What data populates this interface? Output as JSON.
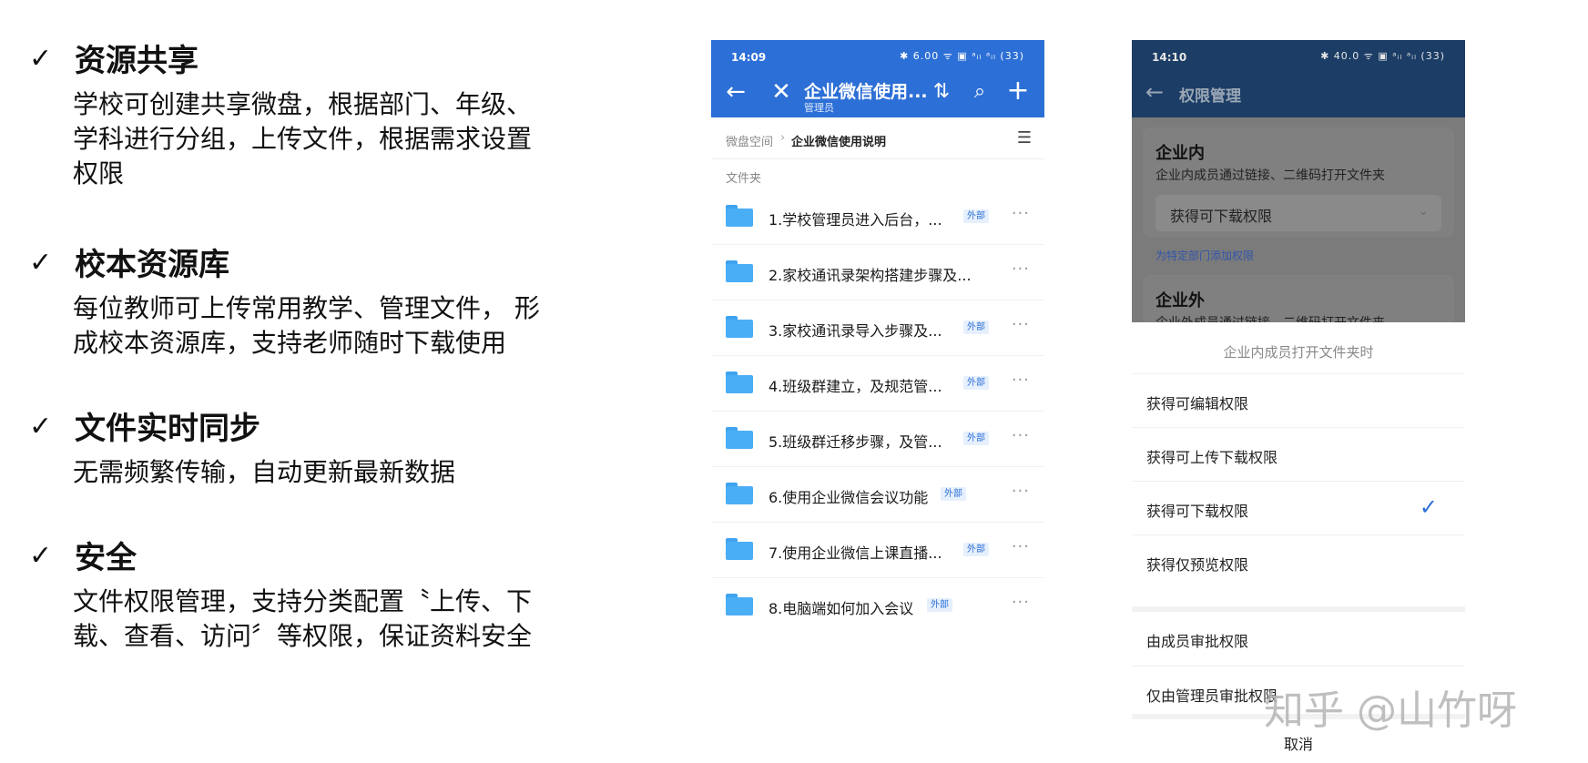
{
  "features": [
    {
      "title": "资源共享",
      "desc": "学校可创建共享微盘，根据部门、年级、\n 学科进行分组，上传文件，根据需求设置\n 权限"
    },
    {
      "title": "校本资源库",
      "desc": "每位教师可上传常用教学、管理文件，  形\n 成校本资源库，支持老师随时下载使用"
    },
    {
      "title": "文件实时同步",
      "desc": "无需频繁传输，自动更新最新数据"
    },
    {
      "title": "安全",
      "desc": "文件权限管理，支持分类配置〝上传、下\n 载、查看、访问〞等权限，保证资料安全"
    }
  ],
  "check_glyph": "✓",
  "phone1": {
    "status_time": "14:09",
    "status_icons": "✱ 6.00 ᯤ ▣ ᵃᵢₗ ᵃᵢₗ (33)",
    "title": "企业微信使用...",
    "subtitle": "管理员",
    "breadcrumb_root": "微盘空间",
    "breadcrumb_sep": "›",
    "breadcrumb_current": "企业微信使用说明",
    "section_label": "文件夹",
    "icons": {
      "back": "←",
      "close": "✕",
      "sort": "⇅",
      "search": "⌕",
      "add": "+",
      "list": "☰",
      "more": "···"
    },
    "files": [
      {
        "name": "1.学校管理员进入后台，...",
        "badge": "外部"
      },
      {
        "name": "2.家校通讯录架构搭建步骤及...",
        "badge": ""
      },
      {
        "name": "3.家校通讯录导入步骤及...",
        "badge": "外部"
      },
      {
        "name": "4.班级群建立，及规范管...",
        "badge": "外部"
      },
      {
        "name": "5.班级群迁移步骤，及管...",
        "badge": "外部"
      },
      {
        "name": "6.使用企业微信会议功能",
        "badge": "外部"
      },
      {
        "name": "7.使用企业微信上课直播...",
        "badge": "外部"
      },
      {
        "name": "8.电脑端如何加入会议",
        "badge": "外部"
      }
    ]
  },
  "phone2": {
    "status_time": "14:10",
    "status_icons": "✱ 40.0 ᯤ ▣ ᵃᵢₗ ᵃᵢₗ (33)",
    "title": "权限管理",
    "back_icon": "←",
    "inner": {
      "title": "企业内",
      "desc": "企业内成员通过链接、二维码打开文件夹",
      "select_value": "获得可下载权限",
      "chevron": "⌄"
    },
    "dept_link": "为特定部门添加权限",
    "outer": {
      "title": "企业外",
      "desc": "企业外成员通过链接、二维码打开文件夹"
    },
    "sheet_title": "企业内成员打开文件夹时",
    "options": [
      {
        "label": "获得可编辑权限",
        "selected": false
      },
      {
        "label": "获得可上传下载权限",
        "selected": false
      },
      {
        "label": "获得可下载权限",
        "selected": true
      },
      {
        "label": "获得仅预览权限",
        "selected": false
      }
    ],
    "approval_options": [
      "由成员审批权限",
      "仅由管理员审批权限"
    ],
    "tick": "✓",
    "cancel": "取消"
  },
  "watermark": "知乎 @山竹呀"
}
